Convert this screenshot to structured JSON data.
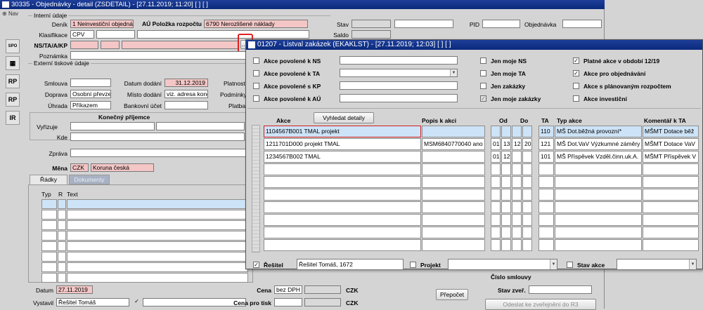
{
  "main": {
    "title": "30335 - Objednávky - detail (ZSDETAIL) - [27.11.2019; 11:20]  [ ]  [ ]",
    "nav": "Nav",
    "section_internal": "Interní údaje",
    "section_external": "Externí tiskové údaje",
    "denik_label": "Deník",
    "denik_value": "1 Neinvestiční objednávky",
    "au_label": "AÚ Položka rozpočtu",
    "au_value": "6790 Nerozlišené náklady",
    "stav_label": "Stav",
    "pid_label": "PID",
    "objednavka_label": "Objednávka",
    "klasifikace_label": "Klasifikace",
    "klasifikace_value": "CPV",
    "saldo_label": "Saldo",
    "ns_label": "NS/TA/A/KP",
    "poznamka_label": "Poznámka",
    "smlouva_label": "Smlouva",
    "datum_dodani_label": "Datum dodání",
    "datum_dodani_value": "31.12.2019",
    "platnost_label": "Platnost",
    "doprava_label": "Doprava",
    "doprava_value": "Osobní převzetí",
    "misto_label": "Místo dodání",
    "misto_value": "viz. adresa konečn",
    "podminky_label": "Podmínky",
    "uhrada_label": "Úhrada",
    "uhrada_value": "Příkazem",
    "bankovni_label": "Bankovní účet",
    "platba_label": "Platba",
    "konecny_label": "Konečný příjemce",
    "vyrizuje_label": "Vyřizuje",
    "kde_label": "Kde",
    "zprava_label": "Zpráva",
    "mena_label": "Měna",
    "mena_code": "CZK",
    "mena_name": "Koruna česká",
    "tab_radky": "Řádky",
    "tab_dokumenty": "Dokumenty",
    "col_typ": "Typ",
    "col_r": "R",
    "col_text": "Text",
    "datum_label": "Datum",
    "datum_value": "27.11.2019",
    "vystavil_label": "Vystavil",
    "vystavil_value": "Řešitel Tomáš",
    "cena_label": "Cena",
    "cena_value": "bez DPH",
    "cena_pro_tisk_label": "Cena pro tisk",
    "czk1": "CZK",
    "czk2": "CZK",
    "prepocet": "Přepočet",
    "cislo_smlouvy": "Číslo smlouvy",
    "stav_zver": "Stav zveř.",
    "odeslat": "Odeslat ke zveřejnění do R3",
    "tools": [
      "SPO",
      "",
      "RP",
      "RP",
      "IR"
    ]
  },
  "dialog": {
    "title": "01207 - Listval zakázek (EKAKLST) - [27.11.2019; 12:03]  [ ]  [ ]",
    "akce_ns": "Akce povolené k NS",
    "akce_ta": "Akce povolené k TA",
    "akce_kp": "Akce povolené s KP",
    "akce_au": "Akce povolené k AÚ",
    "jen_ns": "Jen moje NS",
    "jen_ta": "Jen moje TA",
    "jen_zakazky": "Jen zakázky",
    "jen_moje_zakazky": "Jen moje zakázky",
    "platne_akce": "Platné akce v období 12/19",
    "akce_objednavani": "Akce pro objednávání",
    "akce_planovany": "Akce s plánovaným rozpočtem",
    "akce_investicni": "Akce investiční",
    "vyhledat": "Vyhledat detaily",
    "col_akce": "Akce",
    "col_popis": "Popis k akci",
    "col_od": "Od",
    "col_do": "Do",
    "col_ta": "TA",
    "col_typ": "Typ akce",
    "col_komentar": "Komentář k TA",
    "rows": [
      {
        "akce": "1104567B001 TMAL projekt",
        "popis": "",
        "od1": "",
        "od2": "",
        "do1": "",
        "do2": "",
        "ta": "110",
        "typ": "MŠ Dot.běžná provozní*",
        "kom": "MŠMT Dotace běž"
      },
      {
        "akce": "1211701D000 projekt TMAL",
        "popis": "MSM6840770040 ano",
        "od1": "01",
        "od2": "13",
        "do1": "12",
        "do2": "20",
        "ta": "121",
        "typ": "MŠ Dot.VaV Výzkumné záměry",
        "kom": "MŠMT Dotace VaV"
      },
      {
        "akce": "1234567B002 TMAL",
        "popis": "",
        "od1": "01",
        "od2": "12",
        "do1": "",
        "do2": "",
        "ta": "101",
        "typ": "MŠ Příspěvek Vzděl.činn.uk.A.",
        "kom": "MŠMT Příspěvek V"
      }
    ],
    "resitel_label": "Řešitel",
    "resitel_value": "Řešitel Tomáš, 1672",
    "projekt_label": "Projekt",
    "stav_akce_label": "Stav akce"
  }
}
